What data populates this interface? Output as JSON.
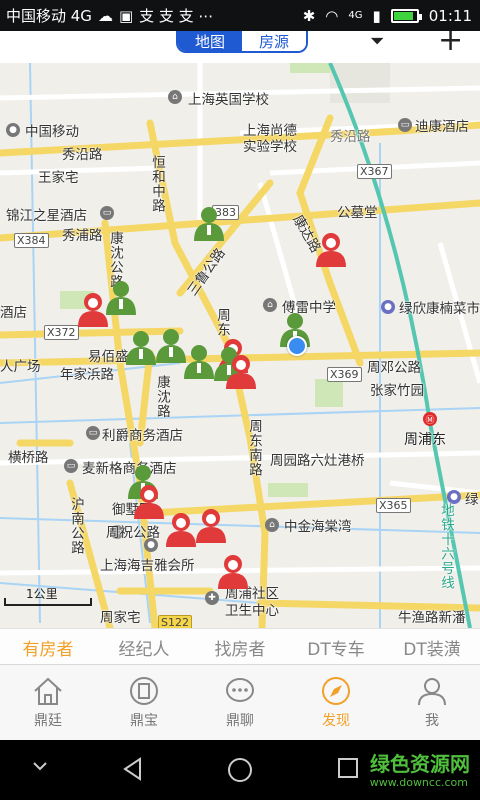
{
  "status_bar": {
    "carrier": "中国移动 4G",
    "extra_icons": "支 支 支 ⋯",
    "signal_label": "4G",
    "time": "01:11"
  },
  "header": {
    "seg_map": "地图",
    "seg_houses": "房源"
  },
  "map": {
    "places": {
      "yingguo_school": "上海英国学校",
      "cmcc": "中国移动",
      "xiuyan_rd_w": "秀沿路",
      "shangde_school_1": "上海尚德",
      "shangde_school_2": "实验学校",
      "xiuyan_rd_e": "秀沿路",
      "dichuan_hotel": "迪康酒店",
      "wangjiazhai": "王家宅",
      "hengpu_rd": "恒和中路",
      "jinjiang_hotel": "锦江之星酒店",
      "xiupu_rd": "秀浦路",
      "gongmutang": "公墓堂",
      "kangyuan_rd": "康沈公路",
      "sanlu_rd": "三鲁公路",
      "kangda_rd": "康达路",
      "hotel_w": "酒店",
      "chuanlei_school": "傅雷中学",
      "lvxin_kangnan": "绿欣康楠菜市",
      "yimingyuan": "易佰盛",
      "guangchang": "人广场",
      "nianjiabang_rd": "年家浜路",
      "zhoudeng_rd": "周邓公路",
      "zhangjiazhuyuan": "张家竹园",
      "kangshen_rd": "康沈路",
      "zhoudong_rd": "周东南路",
      "lijue_hotel": "利爵商务酒店",
      "zhoupu_east": "周浦东",
      "hengqiao_rd": "横桥路",
      "maixin_hotel": "麦新格商务酒店",
      "zhouyuan_rd": "周园路六灶港桥",
      "yuyuan": "御墅园",
      "zhouzhu_rd": "周祝公路",
      "hunan_rd": "沪南公路",
      "zhongjin_haitang": "中金海棠湾",
      "haiji_club": "上海海吉雅会所",
      "zhoupu_clinic_1": "周浦社区",
      "zhoupu_clinic_2": "卫生中心",
      "zhoujiazhai": "周家宅",
      "niuyu_rd": "牛渔路新潘",
      "metro_line": "地铁十六号线",
      "lv_e": "绿"
    },
    "shields": {
      "x367": "X367",
      "s383": "383",
      "x384": "X384",
      "x372": "X372",
      "x369": "X369",
      "x365": "X365",
      "s122": "S122"
    },
    "scale_label": "1公里",
    "colors": {
      "agent": "#5a9a3b",
      "owner": "#e03a3a",
      "road_yellow": "#f5d765",
      "road_white": "#ffffff",
      "water": "#a9d4f5",
      "green": "#cfe6b6",
      "metro": "#55c6b0"
    }
  },
  "categories": {
    "owner": "有房者",
    "agent": "经纪人",
    "seeker": "找房者",
    "dt_car": "DT专车",
    "dt_deco": "DT装潢"
  },
  "tabs": {
    "home": "鼎廷",
    "bao": "鼎宝",
    "chat": "鼎聊",
    "discover": "发现",
    "me": "我"
  },
  "watermark": {
    "title": "绿色资源网",
    "url": "www.downcc.com"
  }
}
